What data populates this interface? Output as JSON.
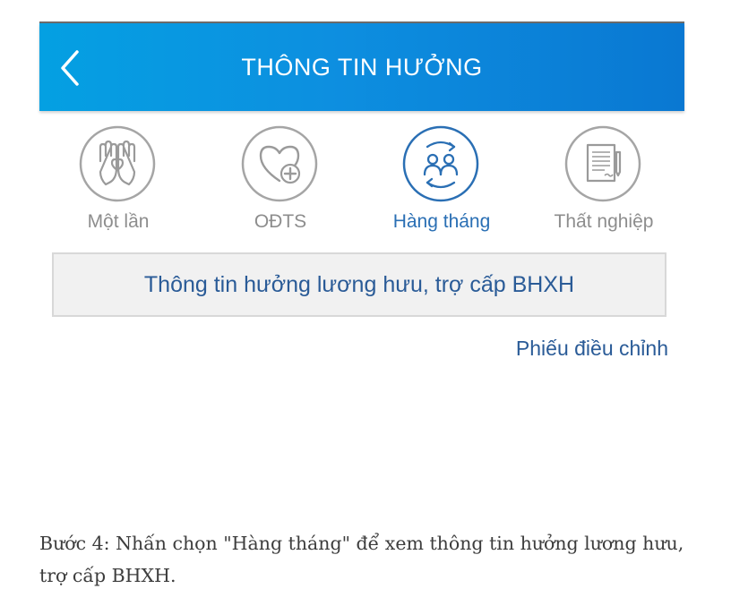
{
  "header": {
    "title": "THÔNG TIN HƯỞNG",
    "back_icon": "chevron-left-icon"
  },
  "tabs": [
    {
      "label": "Một lần",
      "icon": "hands-heart-icon",
      "active": false
    },
    {
      "label": "OĐTS",
      "icon": "heart-plus-icon",
      "active": false
    },
    {
      "label": "Hàng tháng",
      "icon": "people-cycle-icon",
      "active": true
    },
    {
      "label": "Thất nghiệp",
      "icon": "document-pen-icon",
      "active": false
    }
  ],
  "info_box": {
    "text": "Thông tin hưởng lương hưu, trợ cấp BHXH"
  },
  "adjust_link": {
    "text": "Phiếu điều chỉnh"
  },
  "caption": {
    "text": "Bước 4: Nhấn chọn \"Hàng tháng\" để xem thông tin hưởng lương hưu, trợ cấp BHXH."
  },
  "colors": {
    "header_start": "#04a0e2",
    "header_end": "#0a78d2",
    "active": "#2a6fb4",
    "inactive": "#8d8d8d",
    "link": "#2a5b97"
  }
}
